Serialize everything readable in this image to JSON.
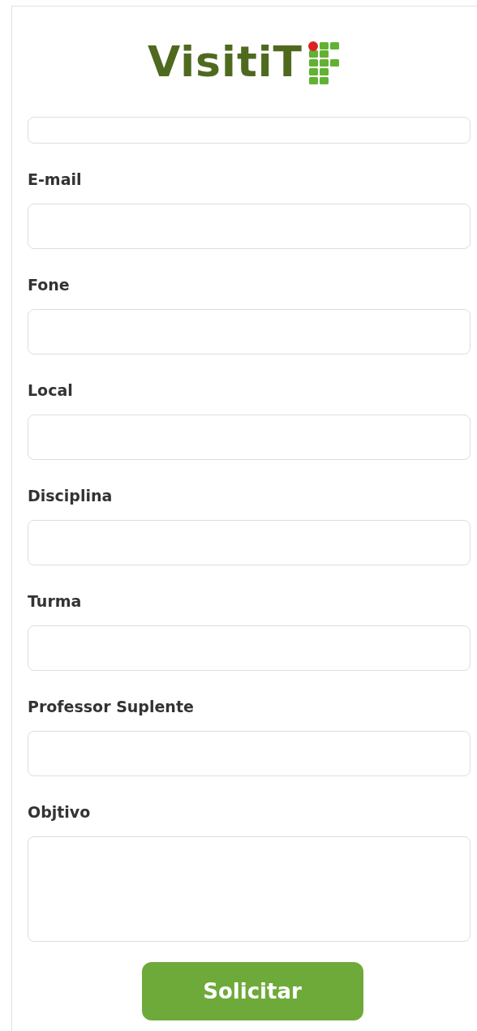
{
  "logo": {
    "text": "VisitiT"
  },
  "fields": [
    {
      "kind": "input",
      "clipped": true
    },
    {
      "kind": "input",
      "clipped": false,
      "label": "E-mail"
    },
    {
      "kind": "input",
      "clipped": false,
      "label": "Fone"
    },
    {
      "kind": "input",
      "clipped": false,
      "label": "Local"
    },
    {
      "kind": "input",
      "clipped": false,
      "label": "Disciplina"
    },
    {
      "kind": "input",
      "clipped": false,
      "label": "Turma"
    },
    {
      "kind": "input",
      "clipped": false,
      "label": "Professor Suplente"
    },
    {
      "kind": "textarea",
      "clipped": false,
      "label": "Objtivo"
    }
  ],
  "submit_button": {
    "label": "Solicitar"
  }
}
